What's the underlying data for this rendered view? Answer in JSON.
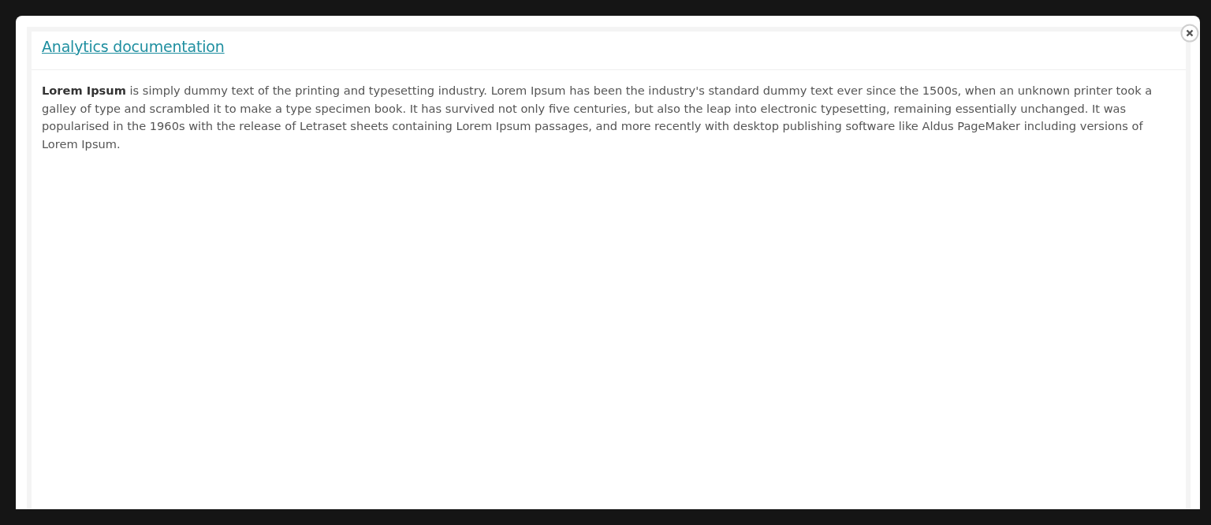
{
  "dialog": {
    "title_link": "Analytics documentation",
    "body": "**Lorem Ipsum** is simply dummy text of the printing and typesetting industry. Lorem Ipsum has been the industry's standard dummy text ever since the 1500s, when an unknown printer took a galley of type and scrambled it to make a type specimen book. It has survived not only five centuries, but also the leap into electronic typesetting, remaining essentially unchanged. It was popularised in the 1960s with the release of Letraset sheets containing Lorem Ipsum passages, and more recently with desktop publishing software like Aldus PageMaker including versions of Lorem Ipsum."
  }
}
